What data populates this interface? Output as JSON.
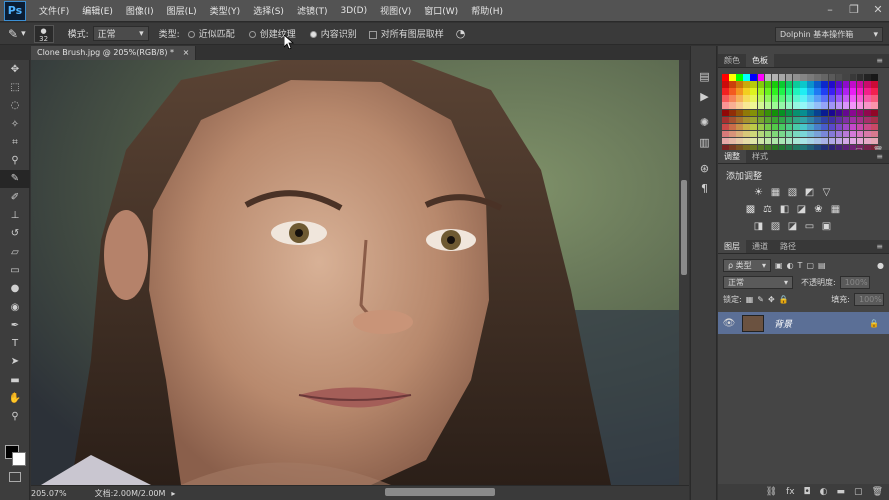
{
  "app": {
    "logo": "Ps",
    "menus": [
      "文件(F)",
      "编辑(E)",
      "图像(I)",
      "图层(L)",
      "类型(Y)",
      "选择(S)",
      "滤镜(T)",
      "3D(D)",
      "视图(V)",
      "窗口(W)",
      "帮助(H)"
    ],
    "window_controls": [
      "minimize-icon",
      "restore-icon",
      "close-icon"
    ]
  },
  "options": {
    "brush_size": "32",
    "mode_label": "模式:",
    "mode_value": "正常",
    "type_label": "类型:",
    "radio_proximity": "近似匹配",
    "radio_texture": "创建纹理",
    "radio_content": "内容识别",
    "sample_all_layers": "对所有图层取样",
    "workspace": "Dolphin 基本操作箱"
  },
  "document": {
    "tab_title": "Clone Brush.jpg @ 205%(RGB/8) *",
    "zoom": "205.07%",
    "doc_size": "文档:2.00M/2.00M"
  },
  "tools": [
    "move-tool",
    "marquee-tool",
    "lasso-tool",
    "quick-select-tool",
    "crop-tool",
    "eyedropper-tool",
    "spot-healing-brush-tool",
    "brush-tool",
    "clone-stamp-tool",
    "history-brush-tool",
    "eraser-tool",
    "gradient-tool",
    "blur-tool",
    "dodge-tool",
    "pen-tool",
    "type-tool",
    "path-select-tool",
    "shape-tool",
    "hand-tool",
    "zoom-tool"
  ],
  "swatches_panel": {
    "tabs": [
      "颜色",
      "色板"
    ],
    "active_tab": "色板"
  },
  "adjustments_panel": {
    "tabs": [
      "调整",
      "样式"
    ],
    "active_tab": "调整",
    "heading": "添加调整"
  },
  "layers_panel": {
    "tabs": [
      "图层",
      "通道",
      "路径"
    ],
    "active_tab": "图层",
    "filter_kind": "ρ 类型",
    "blend_mode": "正常",
    "opacity_label": "不透明度:",
    "opacity_value": "100%",
    "lock_label": "锁定:",
    "fill_label": "填充:",
    "fill_value": "100%",
    "layers": [
      {
        "name": "背景",
        "visible": true,
        "locked": true
      }
    ]
  },
  "colors": {
    "selected_layer": "#5b6f96",
    "foreground": "#000000",
    "background": "#ffffff"
  }
}
